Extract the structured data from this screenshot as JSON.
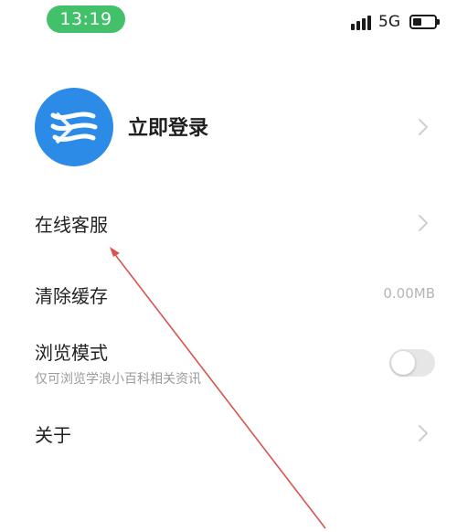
{
  "status_bar": {
    "time": "13:19",
    "network": "5G",
    "signal_icon": "signal-bars-icon",
    "battery_icon": "battery-icon",
    "time_pill_color": "#43c06a"
  },
  "profile": {
    "login_label": "立即登录",
    "avatar_icon": "waves-logo-icon",
    "avatar_color": "#2b8be6"
  },
  "menu": {
    "customer_service": {
      "label": "在线客服"
    },
    "clear_cache": {
      "label": "清除缓存",
      "value": "0.00MB"
    },
    "browse_mode": {
      "label": "浏览模式",
      "description": "仅可浏览学浪小百科相关资讯",
      "enabled": false
    },
    "about": {
      "label": "关于"
    }
  },
  "annotation": {
    "arrow_color": "#d9534f",
    "arrow_target": "在线客服"
  }
}
